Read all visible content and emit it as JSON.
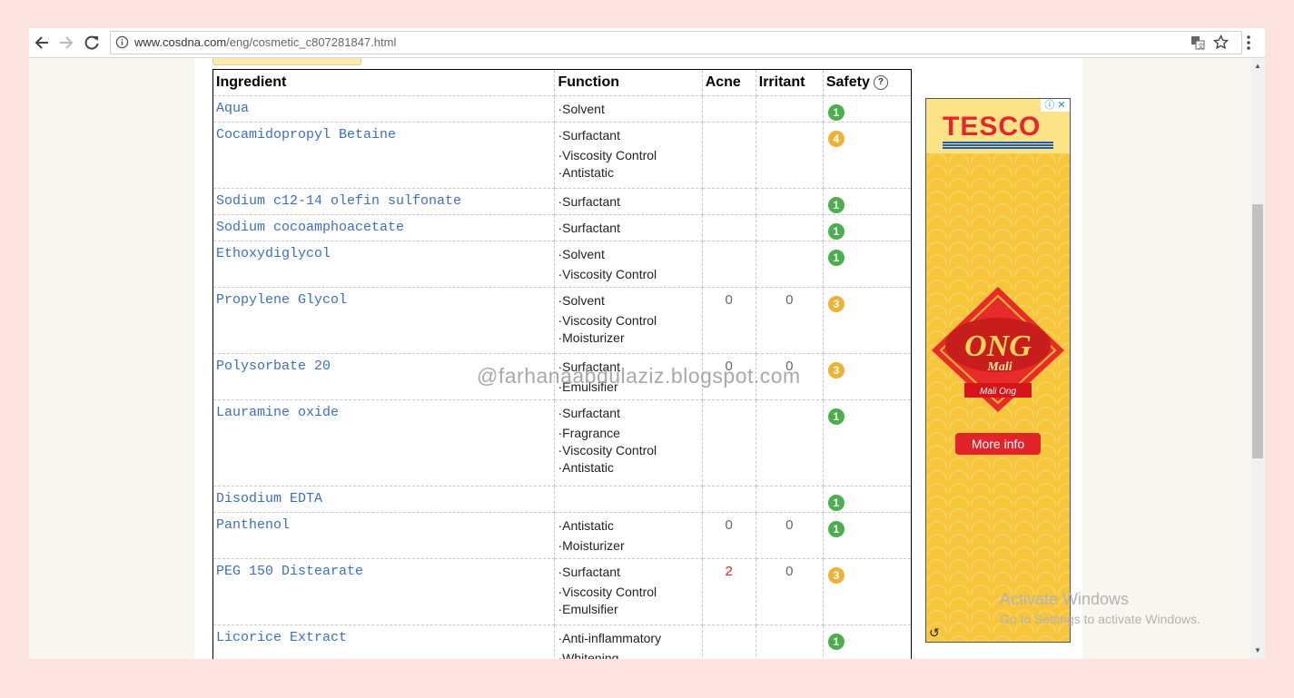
{
  "browser": {
    "url_domain": "www.cosdna.com",
    "url_path": "/eng/cosmetic_c807281847.html"
  },
  "table": {
    "headers": [
      "Ingredient",
      "Function",
      "Acne",
      "Irritant",
      "Safety"
    ],
    "rows": [
      {
        "name": "Aqua",
        "functions": [
          "·Solvent"
        ],
        "acne": "",
        "irritant": "",
        "safety": "1",
        "color": "g"
      },
      {
        "name": "Cocamidopropyl Betaine",
        "functions": [
          "·Surfactant",
          "·Viscosity Control",
          "·Antistatic"
        ],
        "acne": "",
        "irritant": "",
        "safety": "4",
        "color": "o"
      },
      {
        "name": "Sodium c12-14 olefin sulfonate",
        "functions": [
          "·Surfactant"
        ],
        "acne": "",
        "irritant": "",
        "safety": "1",
        "color": "g"
      },
      {
        "name": "Sodium cocoamphoacetate",
        "functions": [
          "·Surfactant"
        ],
        "acne": "",
        "irritant": "",
        "safety": "1",
        "color": "g"
      },
      {
        "name": "Ethoxydiglycol",
        "functions": [
          "·Solvent",
          "·Viscosity Control"
        ],
        "acne": "",
        "irritant": "",
        "safety": "1",
        "color": "g"
      },
      {
        "name": "Propylene Glycol",
        "functions": [
          "·Solvent",
          "·Viscosity Control",
          "·Moisturizer"
        ],
        "acne": "0",
        "irritant": "0",
        "safety": "3",
        "color": "o"
      },
      {
        "name": "Polysorbate 20",
        "functions": [
          "·Surfactant",
          "·Emulsifier"
        ],
        "acne": "0",
        "irritant": "0",
        "safety": "3",
        "color": "o"
      },
      {
        "name": "Lauramine oxide",
        "functions": [
          "·Surfactant",
          "·Fragrance",
          "·Viscosity Control",
          "·Antistatic"
        ],
        "acne": "",
        "irritant": "",
        "safety": "1",
        "color": "g"
      },
      {
        "name": "Disodium EDTA",
        "functions": [],
        "acne": "",
        "irritant": "",
        "safety": "1",
        "color": "g"
      },
      {
        "name": "Panthenol",
        "functions": [
          "·Antistatic",
          "·Moisturizer"
        ],
        "acne": "0",
        "irritant": "0",
        "safety": "1",
        "color": "g"
      },
      {
        "name": "PEG 150 Distearate",
        "functions": [
          "·Surfactant",
          "·Viscosity Control",
          "·Emulsifier"
        ],
        "acne": "2",
        "irritant": "0",
        "safety": "3",
        "color": "o",
        "acne_red": true
      },
      {
        "name": "Licorice Extract",
        "functions": [
          "·Anti-inflammatory",
          "·Whitening"
        ],
        "acne": "",
        "irritant": "",
        "safety": "1",
        "color": "g"
      }
    ]
  },
  "watermark": "@farhanaabdulaziz.blogspot.com",
  "ad": {
    "brand": "TESCO",
    "emblem_title": "ONG",
    "emblem_sub": "Mali",
    "emblem_ribbon": "Mali Ong",
    "button": "More info"
  },
  "activate": {
    "title": "Activate Windows",
    "sub": "Go to Settings to activate Windows."
  }
}
